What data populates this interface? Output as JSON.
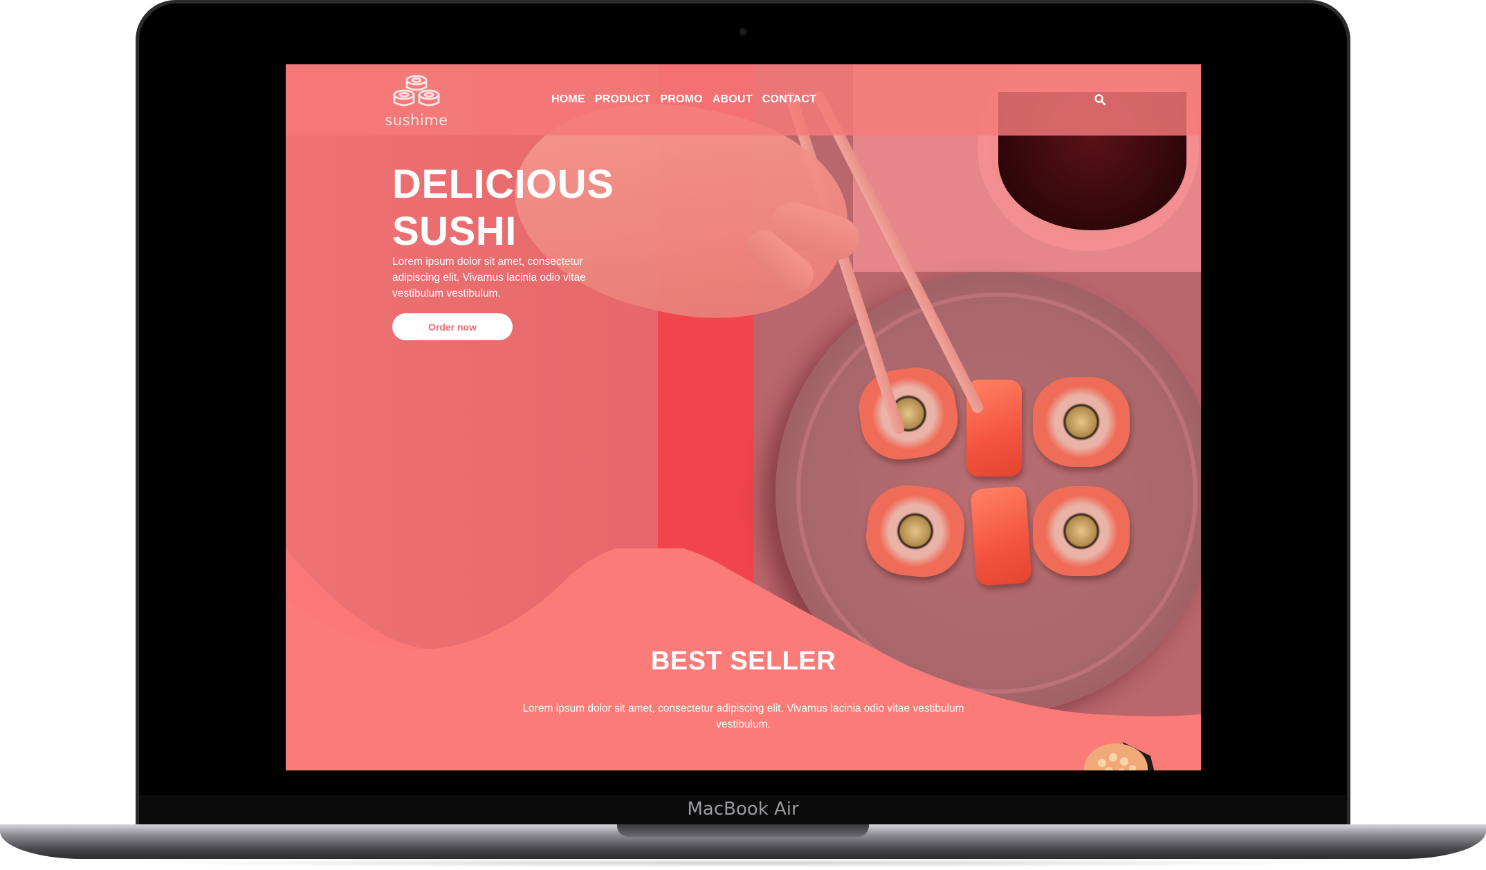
{
  "device": {
    "model_label": "MacBook Air"
  },
  "site": {
    "logo_text": "sushime",
    "nav": [
      {
        "label": "HOME"
      },
      {
        "label": "PRODUCT"
      },
      {
        "label": "PROMO"
      },
      {
        "label": "ABOUT"
      },
      {
        "label": "CONTACT"
      }
    ],
    "search_icon": "search-icon",
    "colors": {
      "primary": "#f57a7a",
      "hero_left": "#e86a6e",
      "accent_red": "#f2444f",
      "button_text": "#f06a6e"
    }
  },
  "hero": {
    "title_line1": "DELICIOUS",
    "title_line2": "SUSHI",
    "text": "Lorem ipsum dolor sit amet, consectetur adipiscing elit. Vivamus lacinia odio vitae vestibulum vestibulum.",
    "cta_label": "Order now"
  },
  "best_seller": {
    "title": "BEST SELLER",
    "text": "Lorem ipsum dolor sit amet, consectetur adipiscing elit. Vivamus lacinia odio vitae vestibulum vestibulum."
  }
}
